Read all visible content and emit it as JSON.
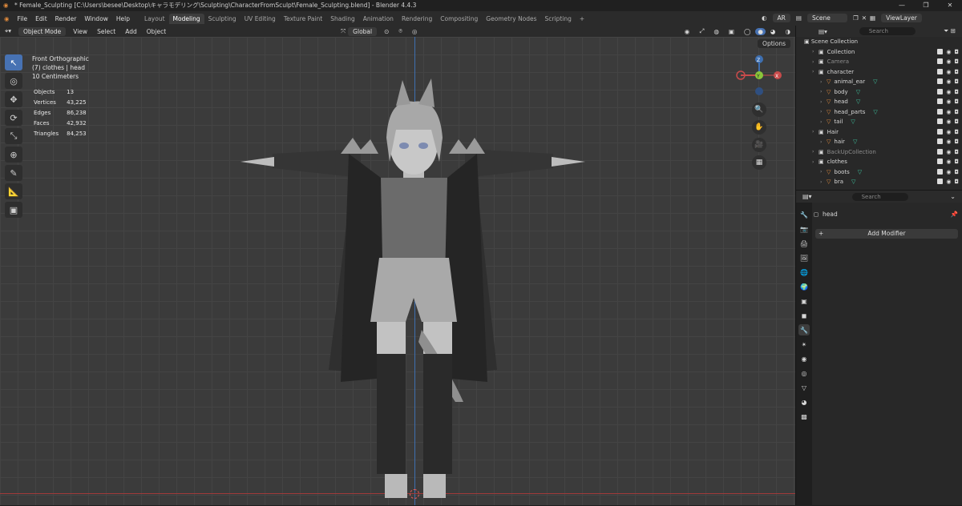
{
  "titlebar": {
    "title": "* Female_Sculpting [C:\\Users\\besee\\Desktop\\キャラモデリング\\Sculpting\\CharacterFromSculpt\\Female_Sculpting.blend] - Blender 4.4.3",
    "min": "—",
    "max": "❐",
    "close": "✕"
  },
  "menu": [
    "File",
    "Edit",
    "Render",
    "Window",
    "Help"
  ],
  "workspaces": [
    "Layout",
    "Modeling",
    "Sculpting",
    "UV Editing",
    "Texture Paint",
    "Shading",
    "Animation",
    "Rendering",
    "Compositing",
    "Geometry Nodes",
    "Scripting"
  ],
  "active_workspace": "Modeling",
  "topright": {
    "engine": "AR",
    "scene": "Scene",
    "viewlayer": "ViewLayer"
  },
  "viewheader": {
    "mode": "Object Mode",
    "view": "View",
    "select": "Select",
    "add": "Add",
    "object": "Object",
    "orientation": "Global",
    "options": "Options"
  },
  "viewport": {
    "view_name": "Front Orthographic",
    "selection": "(7) clothes | head",
    "scale": "10 Centimeters"
  },
  "stats": [
    [
      "Objects",
      "13"
    ],
    [
      "Vertices",
      "43,225"
    ],
    [
      "Edges",
      "86,238"
    ],
    [
      "Faces",
      "42,932"
    ],
    [
      "Triangles",
      "84,253"
    ]
  ],
  "outliner": {
    "search": "Search",
    "root": "Scene Collection",
    "rows": [
      {
        "label": "Collection",
        "indent": 1,
        "kind": "collection"
      },
      {
        "label": "Camera",
        "indent": 1,
        "kind": "dim"
      },
      {
        "label": "character",
        "indent": 1,
        "kind": "collection"
      },
      {
        "label": "animal_ear",
        "indent": 2,
        "kind": "mesh"
      },
      {
        "label": "body",
        "indent": 2,
        "kind": "mesh"
      },
      {
        "label": "head",
        "indent": 2,
        "kind": "mesh"
      },
      {
        "label": "head_parts",
        "indent": 2,
        "kind": "mesh"
      },
      {
        "label": "tail",
        "indent": 2,
        "kind": "mesh"
      },
      {
        "label": "Hair",
        "indent": 1,
        "kind": "collection"
      },
      {
        "label": "hair",
        "indent": 2,
        "kind": "mesh"
      },
      {
        "label": "BackUpCollection",
        "indent": 1,
        "kind": "dim"
      },
      {
        "label": "clothes",
        "indent": 1,
        "kind": "collection"
      },
      {
        "label": "boots",
        "indent": 2,
        "kind": "mesh"
      },
      {
        "label": "bra",
        "indent": 2,
        "kind": "mesh"
      }
    ]
  },
  "properties": {
    "search": "Search",
    "object": "head",
    "add_modifier": "Add Modifier"
  },
  "colors": {
    "accent": "#4772b3",
    "mesh_orange": "#e08a3c",
    "mesh_green": "#3fc7a2"
  }
}
